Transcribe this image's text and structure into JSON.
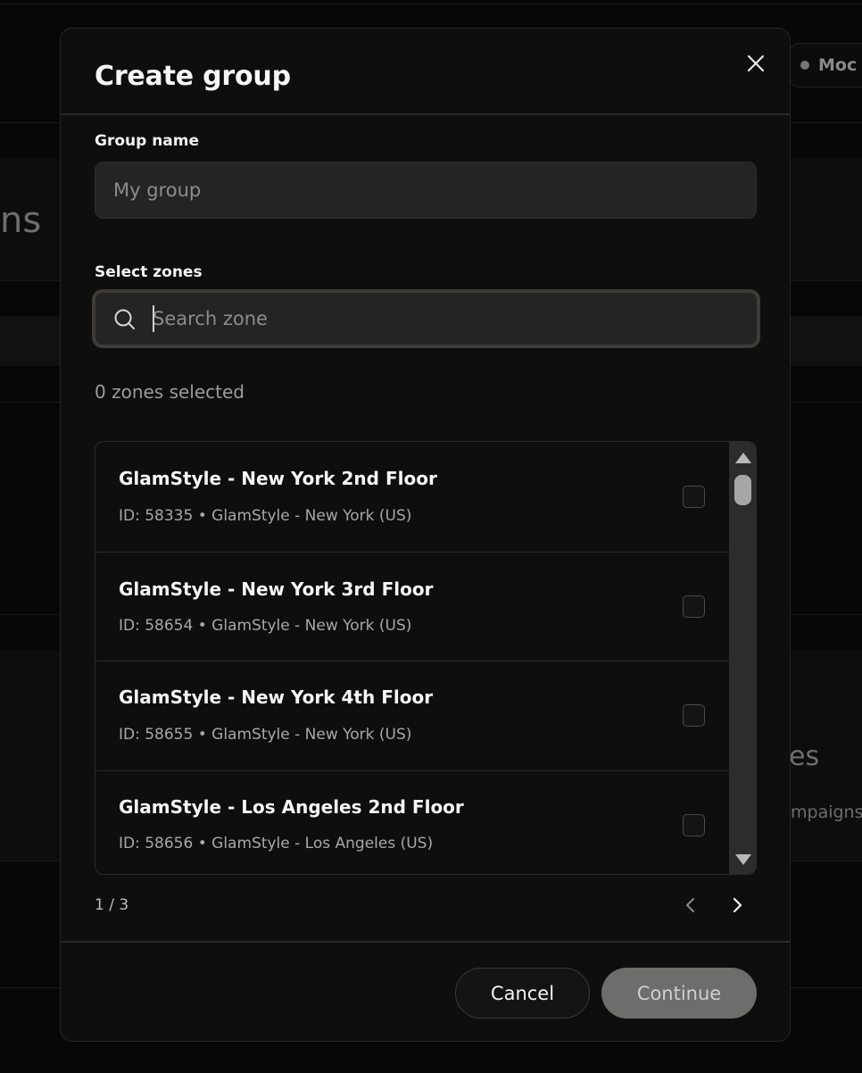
{
  "background": {
    "pill_label": "Moc",
    "fragments": [
      "ns",
      "es",
      "mpaigns"
    ]
  },
  "dialog": {
    "title": "Create group",
    "group_name": {
      "label": "Group name",
      "value": "",
      "placeholder": "My group"
    },
    "select_zones": {
      "label": "Select zones",
      "search_placeholder": "Search zone",
      "selected_count_text": "0 zones selected"
    },
    "zones": [
      {
        "name": "GlamStyle - New York 2nd Floor",
        "meta": "ID: 58335 • GlamStyle - New York (US)",
        "checked": false
      },
      {
        "name": "GlamStyle - New York 3rd Floor",
        "meta": "ID: 58654 • GlamStyle - New York (US)",
        "checked": false
      },
      {
        "name": "GlamStyle - New York 4th Floor",
        "meta": "ID: 58655 • GlamStyle - New York (US)",
        "checked": false
      },
      {
        "name": "GlamStyle - Los Angeles 2nd Floor",
        "meta": "ID: 58656 • GlamStyle - Los Angeles (US)",
        "checked": false
      }
    ],
    "pagination": {
      "current": 1,
      "total": 3,
      "text": "1 / 3"
    },
    "buttons": {
      "cancel": "Cancel",
      "continue": "Continue"
    },
    "icons": {
      "close": "close-icon",
      "search": "search-icon",
      "prev": "chevron-left-icon",
      "next": "chevron-right-icon"
    },
    "colors": {
      "dialog_bg": "#0e0e0e",
      "input_bg": "#242424",
      "continue_disabled": "#6d6d6b",
      "focus_ring": "#3e3b37"
    }
  }
}
